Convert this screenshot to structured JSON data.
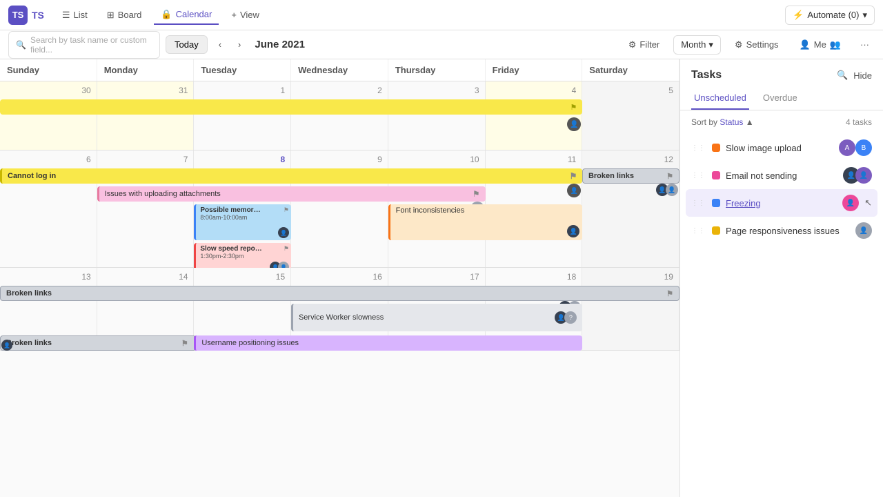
{
  "app": {
    "logo": "TS",
    "nav_items": [
      "List",
      "Board",
      "Calendar"
    ],
    "active_nav": "Calendar",
    "view_btn": "+ View",
    "automate_btn": "Automate (0)"
  },
  "toolbar": {
    "search_placeholder": "Search by task name or custom field...",
    "today_btn": "Today",
    "current_month": "June 2021",
    "filter_btn": "Filter",
    "month_btn": "Month",
    "settings_btn": "Settings",
    "me_btn": "Me",
    "more_btn": "..."
  },
  "calendar": {
    "day_headers": [
      "Sunday",
      "Monday",
      "Tuesday",
      "Wednesday",
      "Thursday",
      "Friday",
      "Saturday"
    ],
    "weeks": [
      {
        "days": [
          30,
          31,
          1,
          2,
          3,
          4,
          5
        ],
        "day_active": [
          false,
          false,
          true,
          true,
          true,
          true,
          true
        ]
      },
      {
        "days": [
          6,
          7,
          8,
          9,
          10,
          11,
          12
        ],
        "day_active": [
          true,
          true,
          true,
          true,
          true,
          true,
          true
        ]
      },
      {
        "days": [
          13,
          14,
          15,
          16,
          17,
          18,
          19
        ],
        "day_active": [
          true,
          true,
          true,
          true,
          true,
          true,
          true
        ]
      }
    ]
  },
  "tasks_panel": {
    "title": "Tasks",
    "hide_btn": "Hide",
    "tabs": [
      "Unscheduled",
      "Overdue"
    ],
    "active_tab": "Unscheduled",
    "sort_label": "Sort by",
    "sort_field": "Status",
    "task_count": "4 tasks",
    "tasks": [
      {
        "name": "Slow image upload",
        "status_color": "#f97316",
        "is_link": false
      },
      {
        "name": "Email not sending",
        "status_color": "#ec4899",
        "is_link": false
      },
      {
        "name": "Freezing",
        "status_color": "#3b82f6",
        "is_link": true
      },
      {
        "name": "Page responsiveness issues",
        "status_color": "#eab308",
        "is_link": false
      }
    ]
  }
}
